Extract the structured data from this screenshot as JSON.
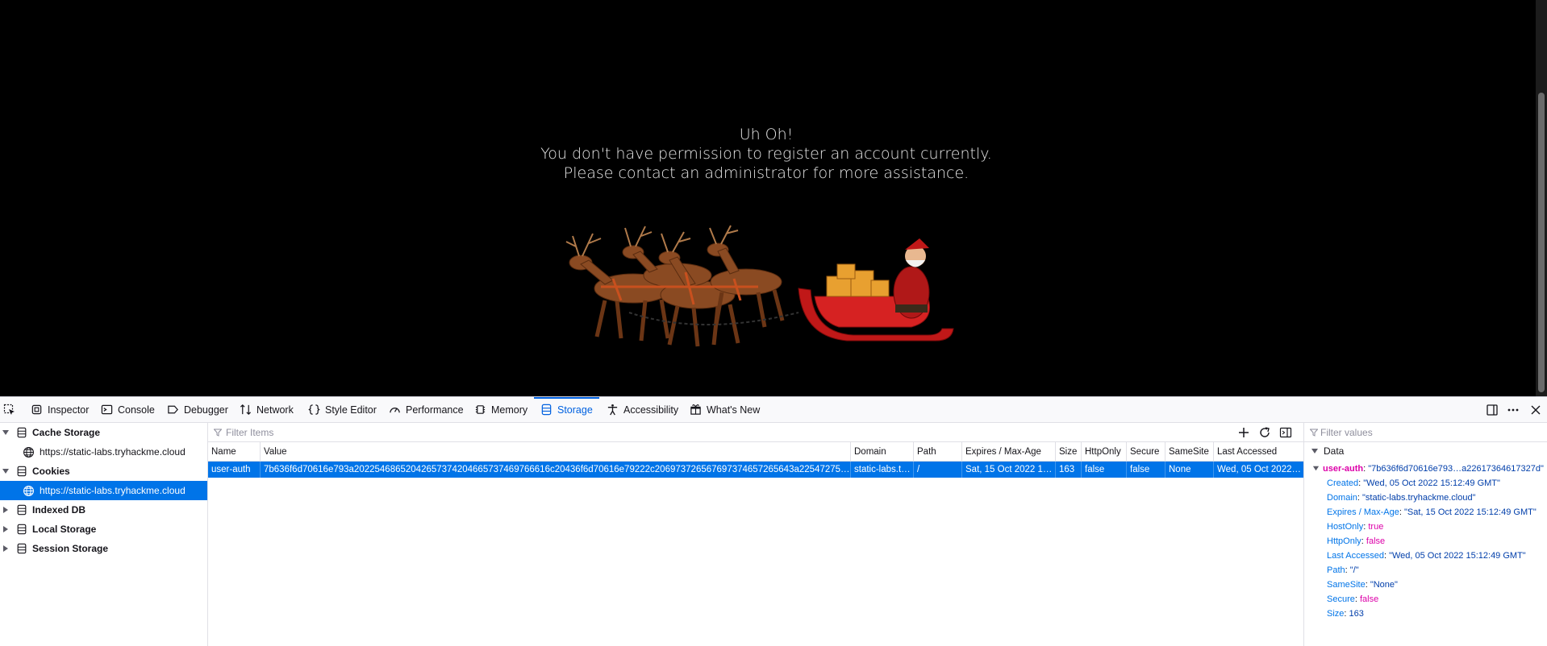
{
  "page": {
    "message_lines": [
      "Uh Oh!",
      "You don't have permission to register an account currently.",
      "Please contact an administrator for more assistance."
    ]
  },
  "devtools": {
    "tabs": [
      {
        "label": "Inspector",
        "icon": "inspector-icon"
      },
      {
        "label": "Console",
        "icon": "console-icon"
      },
      {
        "label": "Debugger",
        "icon": "debugger-icon"
      },
      {
        "label": "Network",
        "icon": "network-icon"
      },
      {
        "label": "Style Editor",
        "icon": "style-editor-icon"
      },
      {
        "label": "Performance",
        "icon": "performance-icon"
      },
      {
        "label": "Memory",
        "icon": "memory-icon"
      },
      {
        "label": "Storage",
        "icon": "storage-icon",
        "active": true
      },
      {
        "label": "Accessibility",
        "icon": "accessibility-icon"
      },
      {
        "label": "What's New",
        "icon": "whats-new-icon"
      }
    ],
    "accent": "#0061e0",
    "tree": {
      "cache_storage": "Cache Storage",
      "cache_origin": "https://static-labs.tryhackme.cloud",
      "cookies": "Cookies",
      "cookies_origin": "https://static-labs.tryhackme.cloud",
      "indexed_db": "Indexed DB",
      "local_storage": "Local Storage",
      "session_storage": "Session Storage"
    },
    "table": {
      "filter_placeholder": "Filter Items",
      "columns": [
        "Name",
        "Value",
        "Domain",
        "Path",
        "Expires / Max-Age",
        "Size",
        "HttpOnly",
        "Secure",
        "SameSite",
        "Last Accessed"
      ],
      "row": {
        "name": "user-auth",
        "value": "7b636f6d70616e793a20225468652042657374204665737469766616c20436f6d70616e79222c206973726567697374657265643a2254727565222…",
        "domain": "static-labs.t…",
        "path": "/",
        "expires": "Sat, 15 Oct 2022 15:…",
        "size": "163",
        "httponly": "false",
        "secure": "false",
        "samesite": "None",
        "last_accessed": "Wed, 05 Oct 2022 1…"
      }
    },
    "data_panel": {
      "filter_placeholder": "Filter values",
      "heading": "Data",
      "root_key": "user-auth",
      "root_value": "\"7b636f6d70616e793…a22617364617327d\"",
      "props": [
        {
          "key": "Created",
          "value": "\"Wed, 05 Oct 2022 15:12:49 GMT\"",
          "type": "s"
        },
        {
          "key": "Domain",
          "value": "\"static-labs.tryhackme.cloud\"",
          "type": "s"
        },
        {
          "key": "Expires / Max-Age",
          "value": "\"Sat, 15 Oct 2022 15:12:49 GMT\"",
          "type": "s"
        },
        {
          "key": "HostOnly",
          "value": "true",
          "type": "b"
        },
        {
          "key": "HttpOnly",
          "value": "false",
          "type": "b"
        },
        {
          "key": "Last Accessed",
          "value": "\"Wed, 05 Oct 2022 15:12:49 GMT\"",
          "type": "s"
        },
        {
          "key": "Path",
          "value": "\"/\"",
          "type": "s"
        },
        {
          "key": "SameSite",
          "value": "\"None\"",
          "type": "s"
        },
        {
          "key": "Secure",
          "value": "false",
          "type": "b"
        },
        {
          "key": "Size",
          "value": "163",
          "type": "n"
        }
      ]
    }
  }
}
